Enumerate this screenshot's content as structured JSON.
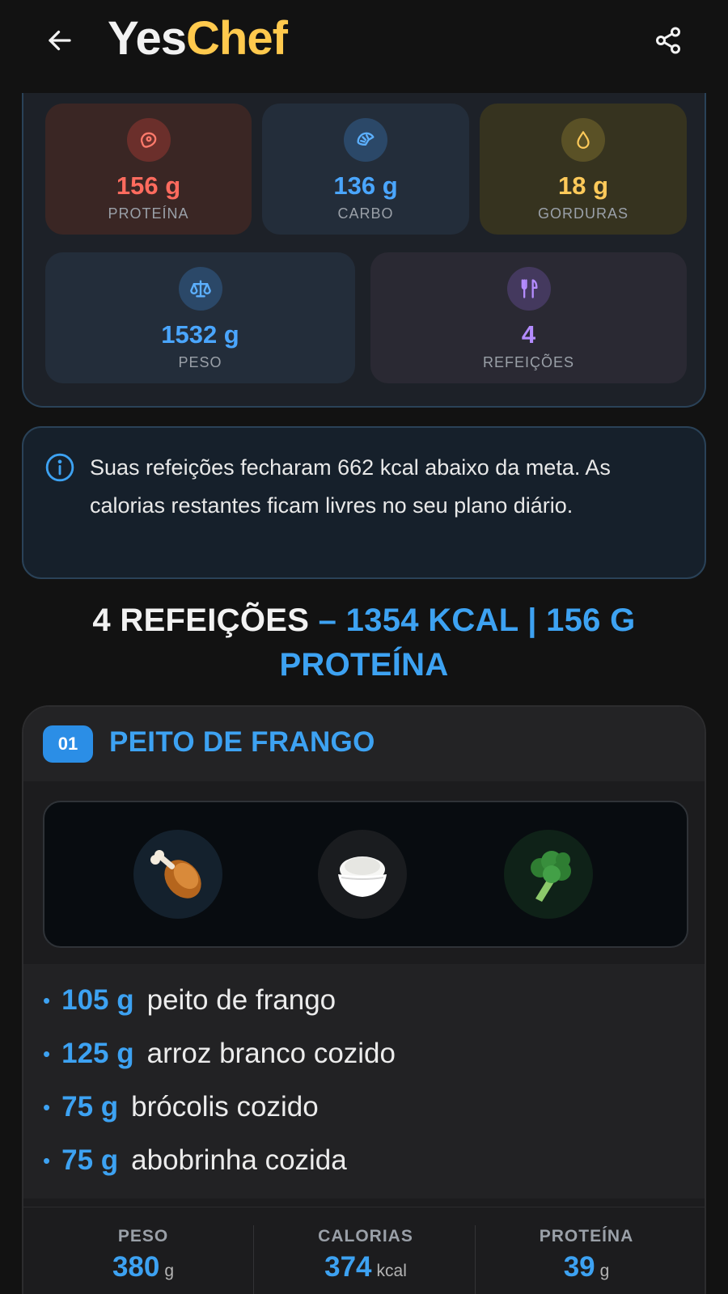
{
  "header": {
    "logo_part1": "Yes",
    "logo_part2": "Chef",
    "back_icon": "arrow-left-icon",
    "share_icon": "share-icon"
  },
  "stats": {
    "protein": {
      "value": "156 g",
      "label": "PROTEÍNA",
      "icon": "meat-icon",
      "color": "#ff6b5e"
    },
    "carbs": {
      "value": "136 g",
      "label": "CARBO",
      "icon": "croissant-icon",
      "color": "#4aa6ff"
    },
    "fat": {
      "value": "18 g",
      "label": "GORDURAS",
      "icon": "drop-icon",
      "color": "#ffca5a"
    },
    "weight": {
      "value": "1532 g",
      "label": "PESO",
      "icon": "scale-icon",
      "color": "#4aa6ff"
    },
    "meals": {
      "value": "4",
      "label": "REFEIÇÕES",
      "icon": "utensils-icon",
      "color": "#b48cff"
    }
  },
  "info": {
    "icon": "info-icon",
    "text": "Suas refeições fecharam 662 kcal abaixo da meta. As calorias restantes ficam livres no seu plano diário."
  },
  "section": {
    "title_white": "4 REFEIÇÕES",
    "title_blue": " – 1354 KCAL | 156 G PROTEÍNA"
  },
  "meal": {
    "number": "01",
    "title": "PEITO DE FRANGO",
    "food_icons": [
      "chicken-leg-icon",
      "rice-bowl-icon",
      "broccoli-icon"
    ],
    "ingredients": [
      {
        "qty": "105 g",
        "name": "peito de frango"
      },
      {
        "qty": "125 g",
        "name": "arroz branco cozido"
      },
      {
        "qty": "75 g",
        "name": "brócolis cozido"
      },
      {
        "qty": "75 g",
        "name": "abobrinha cozida"
      }
    ],
    "totals": {
      "weight": {
        "label": "PESO",
        "value": "380",
        "unit": "g"
      },
      "calories": {
        "label": "CALORIAS",
        "value": "374",
        "unit": "kcal"
      },
      "protein": {
        "label": "PROTEÍNA",
        "value": "39",
        "unit": "g"
      }
    }
  },
  "colors": {
    "accent_blue": "#3da2f2",
    "logo_yellow": "#ffc94d",
    "background": "#121212"
  }
}
